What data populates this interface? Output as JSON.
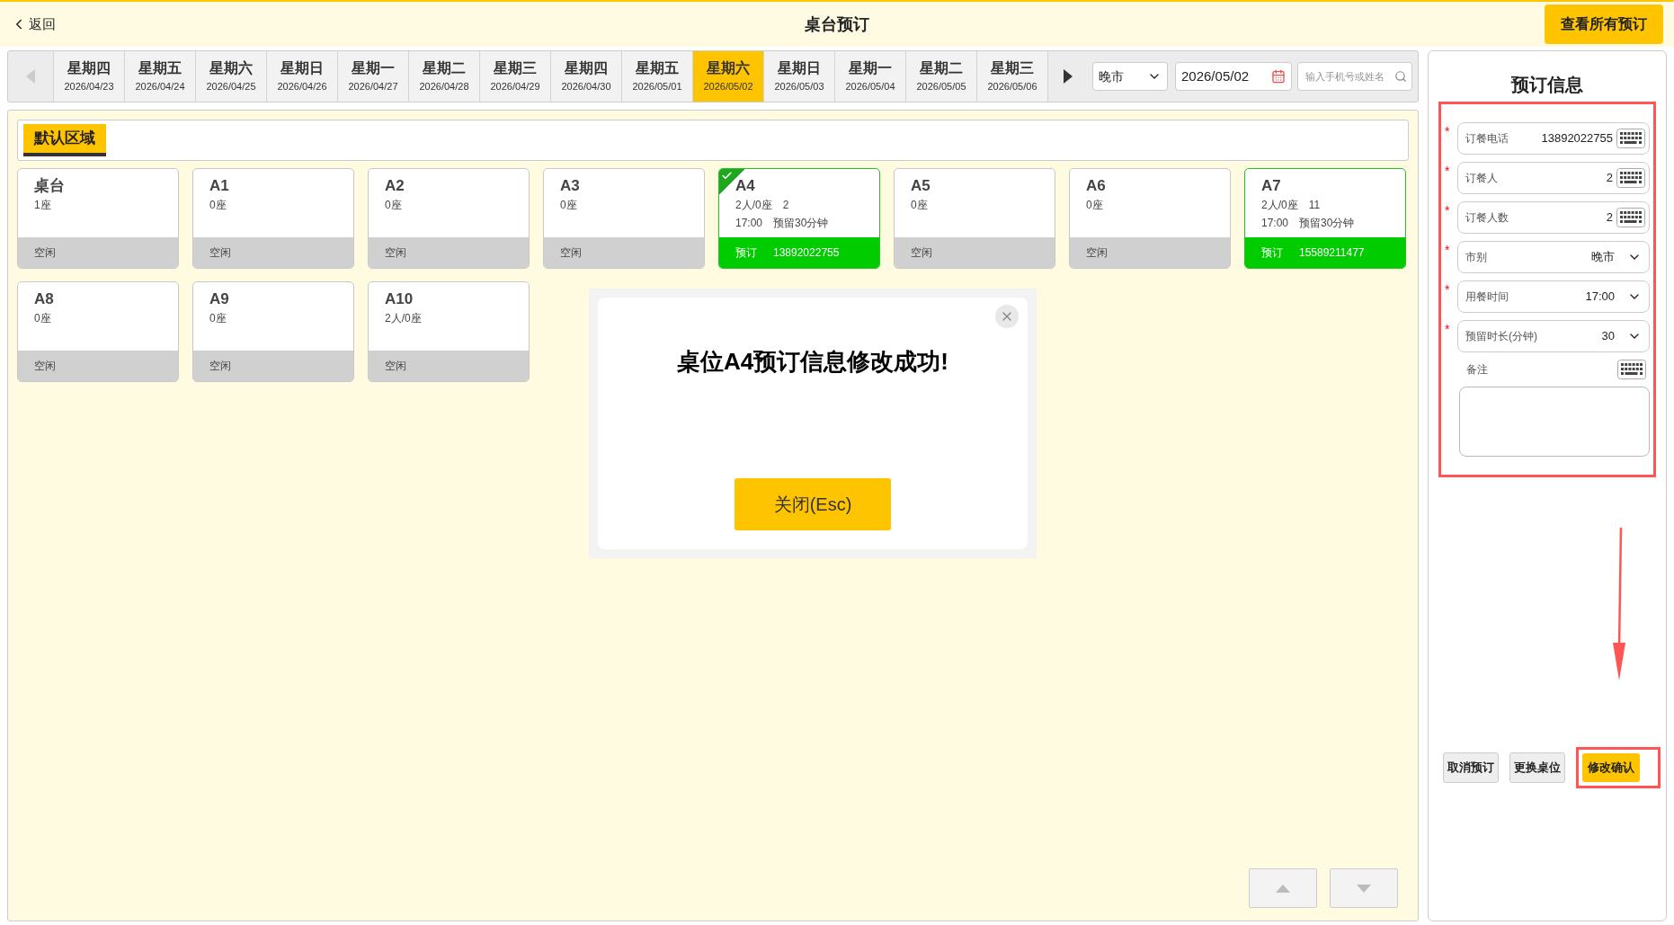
{
  "header": {
    "back_label": "返回",
    "title": "桌台预订",
    "all_bookings_button": "查看所有预订"
  },
  "date_tabs": [
    {
      "weekday": "星期四",
      "date": "2026/04/23",
      "selected": false
    },
    {
      "weekday": "星期五",
      "date": "2026/04/24",
      "selected": false
    },
    {
      "weekday": "星期六",
      "date": "2026/04/25",
      "selected": false
    },
    {
      "weekday": "星期日",
      "date": "2026/04/26",
      "selected": false
    },
    {
      "weekday": "星期一",
      "date": "2026/04/27",
      "selected": false
    },
    {
      "weekday": "星期二",
      "date": "2026/04/28",
      "selected": false
    },
    {
      "weekday": "星期三",
      "date": "2026/04/29",
      "selected": false
    },
    {
      "weekday": "星期四",
      "date": "2026/04/30",
      "selected": false
    },
    {
      "weekday": "星期五",
      "date": "2026/05/01",
      "selected": false
    },
    {
      "weekday": "星期六",
      "date": "2026/05/02",
      "selected": true
    },
    {
      "weekday": "星期日",
      "date": "2026/05/03",
      "selected": false
    },
    {
      "weekday": "星期一",
      "date": "2026/05/04",
      "selected": false
    },
    {
      "weekday": "星期二",
      "date": "2026/05/05",
      "selected": false
    },
    {
      "weekday": "星期三",
      "date": "2026/05/06",
      "selected": false
    }
  ],
  "filters": {
    "meal_period": "晚市",
    "date": "2026/05/02",
    "search_placeholder": "输入手机号或姓名"
  },
  "area_tabs": [
    {
      "label": "默认区域",
      "selected": true
    }
  ],
  "tables": [
    {
      "kind": "idle",
      "name": "桌台",
      "lines": [
        "1座"
      ],
      "footer": [
        "空闲"
      ],
      "selected": false
    },
    {
      "kind": "idle",
      "name": "A1",
      "lines": [
        "0座"
      ],
      "footer": [
        "空闲"
      ],
      "selected": false
    },
    {
      "kind": "idle",
      "name": "A2",
      "lines": [
        "0座"
      ],
      "footer": [
        "空闲"
      ],
      "selected": false
    },
    {
      "kind": "idle",
      "name": "A3",
      "lines": [
        "0座"
      ],
      "footer": [
        "空闲"
      ],
      "selected": false
    },
    {
      "kind": "booked",
      "name": "A4",
      "lines": [
        "2人/0座　2",
        "17:00　预留30分钟"
      ],
      "footer": [
        "预订",
        "13892022755"
      ],
      "selected": true
    },
    {
      "kind": "idle",
      "name": "A5",
      "lines": [
        "0座"
      ],
      "footer": [
        "空闲"
      ],
      "selected": false
    },
    {
      "kind": "idle",
      "name": "A6",
      "lines": [
        "0座"
      ],
      "footer": [
        "空闲"
      ],
      "selected": false
    },
    {
      "kind": "booked",
      "name": "A7",
      "lines": [
        "2人/0座　11",
        "17:00　预留30分钟"
      ],
      "footer": [
        "预订",
        "15589211477"
      ],
      "selected": false
    },
    {
      "kind": "idle",
      "name": "A8",
      "lines": [
        "0座"
      ],
      "footer": [
        "空闲"
      ],
      "selected": false
    },
    {
      "kind": "idle",
      "name": "A9",
      "lines": [
        "0座"
      ],
      "footer": [
        "空闲"
      ],
      "selected": false
    },
    {
      "kind": "idle",
      "name": "A10",
      "lines": [
        "2人/0座"
      ],
      "footer": [
        "空闲"
      ],
      "selected": false
    }
  ],
  "dialog": {
    "message": "桌位A4预订信息修改成功!",
    "close_button": "关闭(Esc)"
  },
  "booking_panel": {
    "title": "预订信息",
    "fields": [
      {
        "kind": "keyboard",
        "label": "订餐电话",
        "value": "13892022755",
        "required": true
      },
      {
        "kind": "keyboard",
        "label": "订餐人",
        "value": "2",
        "required": true
      },
      {
        "kind": "keyboard",
        "label": "订餐人数",
        "value": "2",
        "required": true
      },
      {
        "kind": "select",
        "label": "市别",
        "value": "晚市",
        "required": true
      },
      {
        "kind": "select",
        "label": "用餐时间",
        "value": "17:00",
        "required": true
      },
      {
        "kind": "select",
        "label": "预留时长(分钟)",
        "value": "30",
        "required": true
      }
    ],
    "required_mark": "*",
    "note_label": "备注",
    "buttons": [
      {
        "label": "取消预订",
        "primary": false
      },
      {
        "label": "更换桌位",
        "primary": false
      },
      {
        "label": "修改确认",
        "primary": true
      }
    ]
  }
}
